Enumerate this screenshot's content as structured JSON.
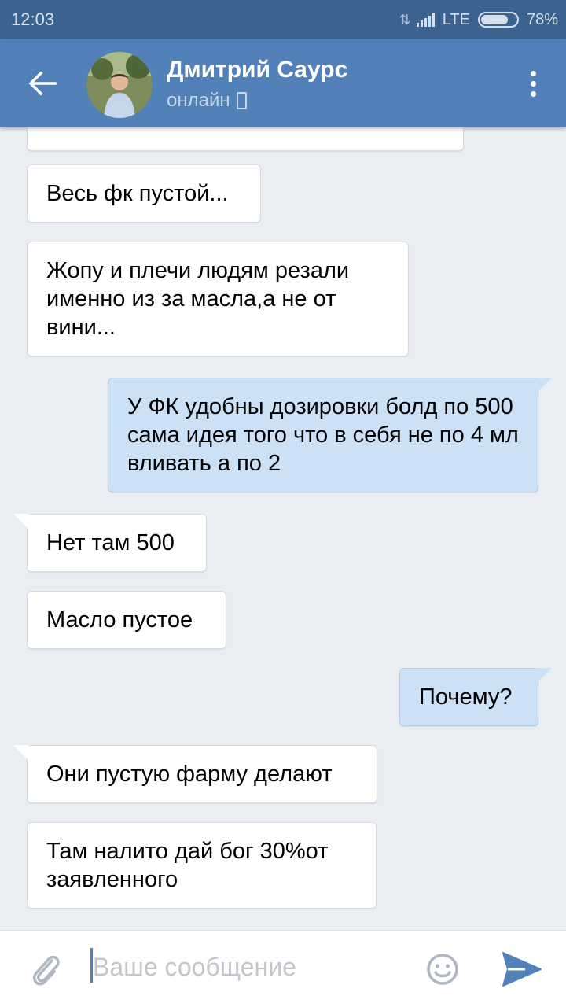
{
  "status_bar": {
    "time": "12:03",
    "network": "LTE",
    "battery": "78%",
    "battery_level": 0.78
  },
  "header": {
    "contact_name": "Дмитрий Саурс",
    "contact_status": "онлайн",
    "back_icon": "arrow-left-icon",
    "menu_icon": "more-vertical-icon"
  },
  "messages": [
    {
      "direction": "in",
      "text": "Весь фк пустой..."
    },
    {
      "direction": "in",
      "text": "Жопу и плечи людям резали именно из за масла,а не от вини..."
    },
    {
      "direction": "out",
      "text": "У ФК удобны дозировки болд по 500 сама идея того что в себя не по 4 мл вливать а по 2"
    },
    {
      "direction": "in",
      "text": "Нет там 500"
    },
    {
      "direction": "in",
      "text": "Масло пустое"
    },
    {
      "direction": "out",
      "text": "Почему?"
    },
    {
      "direction": "in",
      "text": "Они пустую фарму делают"
    },
    {
      "direction": "in",
      "text": "Там налито дай бог 30%от заявленного"
    }
  ],
  "composer": {
    "placeholder": "Ваше сообщение",
    "attach_icon": "paperclip-icon",
    "emoji_icon": "smiley-icon",
    "send_icon": "send-icon"
  },
  "colors": {
    "toolbar": "#5181b8",
    "status_bar": "#3c6290",
    "chat_background": "#eaeef3",
    "incoming_bubble": "#ffffff",
    "outgoing_bubble": "#cce0f6"
  }
}
